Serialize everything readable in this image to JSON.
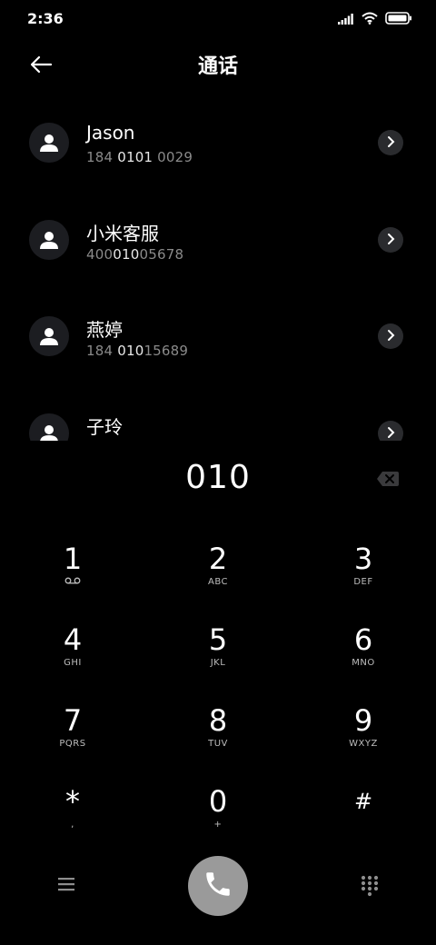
{
  "status_bar": {
    "time": "2:36",
    "icons": [
      "signal-icon",
      "wifi-icon",
      "battery-icon"
    ]
  },
  "header": {
    "title": "通话",
    "back_icon": "arrow-left-icon"
  },
  "contacts": [
    {
      "name": "Jason",
      "number_pre": "184 ",
      "number_match": "0101",
      "number_post": " 0029"
    },
    {
      "name": "小米客服",
      "number_pre": "400",
      "number_match": "010",
      "number_post": "05678"
    },
    {
      "name": "燕婷",
      "number_pre": "184 ",
      "number_match": "010",
      "number_post": "15689"
    },
    {
      "name": "子玲",
      "number_pre": "",
      "number_match": "",
      "number_post": ""
    }
  ],
  "dialer": {
    "input": "010",
    "backspace_icon": "backspace-icon"
  },
  "keypad": [
    {
      "digit": "1",
      "letters": ""
    },
    {
      "digit": "2",
      "letters": "ABC"
    },
    {
      "digit": "3",
      "letters": "DEF"
    },
    {
      "digit": "4",
      "letters": "GHI"
    },
    {
      "digit": "5",
      "letters": "JKL"
    },
    {
      "digit": "6",
      "letters": "MNO"
    },
    {
      "digit": "7",
      "letters": "PQRS"
    },
    {
      "digit": "8",
      "letters": "TUV"
    },
    {
      "digit": "9",
      "letters": "WXYZ"
    },
    {
      "digit": "*",
      "letters": ","
    },
    {
      "digit": "0",
      "letters": "+"
    },
    {
      "digit": "#",
      "letters": ""
    }
  ],
  "bottom_bar": {
    "menu_icon": "menu-icon",
    "call_icon": "phone-icon",
    "keypad_icon": "dialpad-icon"
  },
  "colors": {
    "background": "#000000",
    "call_button": "#9a9a9a",
    "secondary_text": "#8a8a8a"
  }
}
